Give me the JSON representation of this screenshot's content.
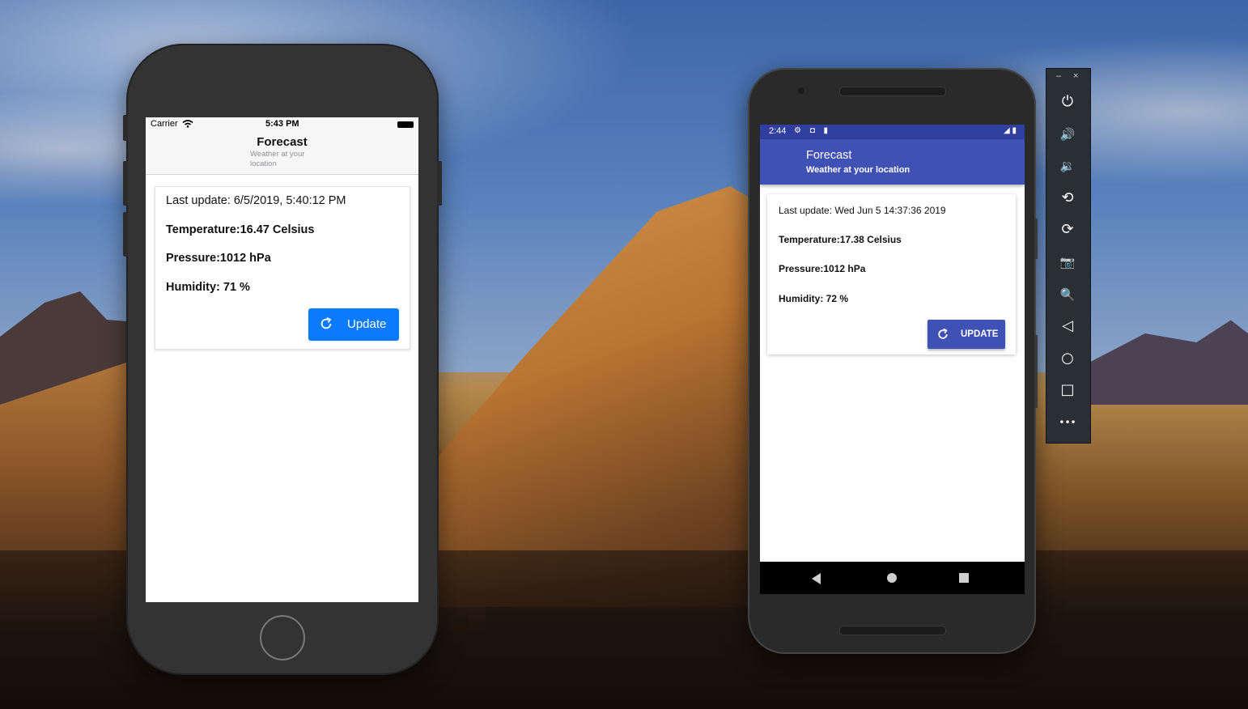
{
  "ios": {
    "status": {
      "carrier": "Carrier",
      "time": "5:43 PM"
    },
    "nav": {
      "title": "Forecast",
      "subtitle": "Weather at your location"
    },
    "card": {
      "last_update": "Last update: 6/5/2019, 5:40:12 PM",
      "temperature": "Temperature:16.47 Celsius",
      "pressure": "Pressure:1012 hPa",
      "humidity": "Humidity: 71 %",
      "button_label": "Update"
    }
  },
  "android": {
    "status": {
      "time": "2:44",
      "icons": "⚙ ◘ ▮",
      "right_icons": "◢ ▮"
    },
    "appbar": {
      "title": "Forecast",
      "subtitle": "Weather at your location"
    },
    "card": {
      "last_update": "Last update: Wed Jun  5 14:37:36 2019",
      "temperature": "Temperature:17.38 Celsius",
      "pressure": "Pressure:1012 hPa",
      "humidity": "Humidity: 72 %",
      "button_label": "UPDATE"
    }
  },
  "emulator_toolbar": {
    "minimize": "–",
    "close": "×",
    "buttons": [
      {
        "name": "power-icon",
        "glyph": "⏻"
      },
      {
        "name": "volume-up-icon",
        "glyph": "🔊"
      },
      {
        "name": "volume-down-icon",
        "glyph": "🔉"
      },
      {
        "name": "rotate-left-icon",
        "glyph": "⟲"
      },
      {
        "name": "rotate-right-icon",
        "glyph": "⟳"
      },
      {
        "name": "camera-icon",
        "glyph": "📷"
      },
      {
        "name": "zoom-icon",
        "glyph": "🔍"
      },
      {
        "name": "back-icon",
        "glyph": "◁"
      },
      {
        "name": "home-icon",
        "glyph": "○"
      },
      {
        "name": "overview-icon",
        "glyph": "□"
      },
      {
        "name": "more-icon",
        "glyph": "•••"
      }
    ]
  }
}
